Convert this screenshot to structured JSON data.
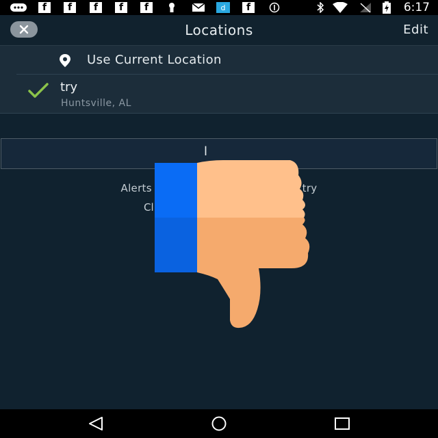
{
  "status_bar": {
    "time": "6:17",
    "fb_glyph": "f",
    "left_icons": [
      "messenger-icon",
      "facebook-icon",
      "facebook-icon",
      "facebook-icon",
      "facebook-icon",
      "facebook-icon",
      "keyhole-icon",
      "mail-icon",
      "dropbox-icon",
      "facebook-icon",
      "info-circle-icon"
    ],
    "right_icons": [
      "bluetooth-icon",
      "wifi-icon",
      "no-signal-icon",
      "battery-icon"
    ]
  },
  "header": {
    "title": "Locations",
    "edit_label": "Edit",
    "close_icon": "close-icon"
  },
  "locations": {
    "use_current_label": "Use Current Location",
    "items": [
      {
        "name": "try",
        "subtitle": "Huntsville, AL",
        "selected": true
      }
    ]
  },
  "add_button": {
    "label": "l"
  },
  "alerts": {
    "line1": "Alerts will                                for try",
    "line2": "Cl"
  },
  "overlay": {
    "icon": "thumbs-down-icon"
  },
  "nav_bar": {
    "icons": [
      "back-icon",
      "home-icon",
      "recents-icon"
    ]
  },
  "colors": {
    "background": "#10222f",
    "list_background": "#1c2d3a",
    "check_green": "#8bc34a",
    "thumb_blue": "#0a6cf5",
    "thumb_skin": "#ffc08b"
  }
}
